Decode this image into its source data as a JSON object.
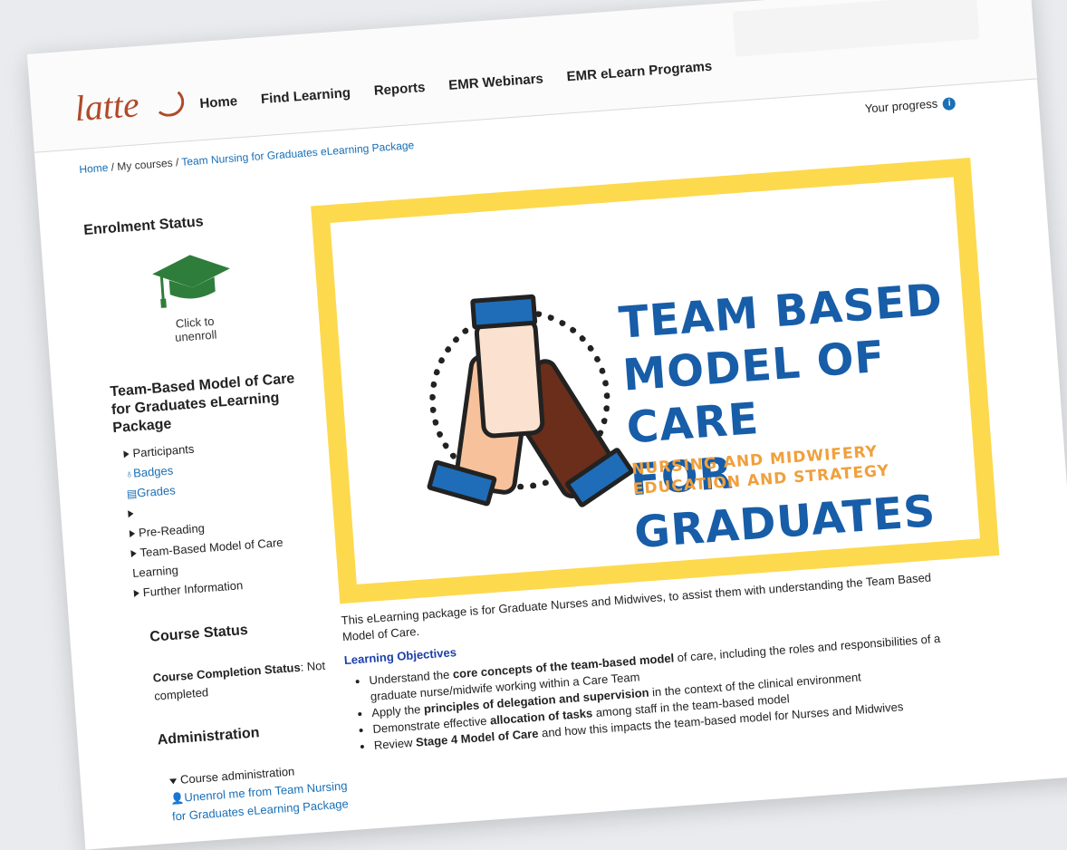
{
  "logo": {
    "text": "latte"
  },
  "nav": [
    "Home",
    "Find Learning",
    "Reports",
    "EMR Webinars",
    "EMR eLearn Programs"
  ],
  "breadcrumb": {
    "home": "Home",
    "my_courses": "My courses",
    "course": "Team Nursing for Graduates eLearning Package"
  },
  "progress": {
    "label": "Your progress"
  },
  "sidebar": {
    "enrolment_heading": "Enrolment Status",
    "unenroll_label": "Click to unenroll",
    "package_title": "Team-Based Model of Care for Graduates eLearning Package",
    "tree": {
      "participants": "Participants",
      "badges": "Badges",
      "grades": "Grades",
      "pre_reading": "Pre-Reading",
      "tbmc_learning": "Team-Based Model of Care Learning",
      "further_info": "Further Information"
    },
    "course_status_heading": "Course Status",
    "completion_label": "Course Completion Status",
    "completion_value": ": Not completed",
    "admin_heading": "Administration",
    "admin_item": "Course administration",
    "unenrol_link": "Unenrol me from Team Nursing for Graduates eLearning Package"
  },
  "banner": {
    "title_line1": "TEAM BASED",
    "title_line2": "MODEL OF CARE",
    "title_line3": "FOR GRADUATES",
    "sub_line1": "NURSING AND MIDWIFERY",
    "sub_line2": "EDUCATION AND STRATEGY",
    "colors": {
      "frame": "#fdd94e",
      "title": "#175da8",
      "subtitle": "#f0a03c"
    }
  },
  "description": {
    "intro": "This eLearning package is for Graduate Nurses and Midwives, to assist them with understanding the Team Based Model of Care.",
    "objectives_heading": "Learning Objectives",
    "objectives": [
      {
        "pre": "Understand the ",
        "bold": "core concepts of the team-based model",
        "post": " of care, including the roles and responsibilities of a graduate nurse/midwife working within a Care Team"
      },
      {
        "pre": "Apply the ",
        "bold": "principles of delegation and supervision",
        "post": " in the context of the clinical environment"
      },
      {
        "pre": "Demonstrate effective ",
        "bold": "allocation of tasks",
        "post": " among staff in the team-based model"
      },
      {
        "pre": "Review ",
        "bold": "Stage 4 Model of Care",
        "post": " and how this impacts the team-based model for Nurses and Midwives"
      }
    ]
  }
}
